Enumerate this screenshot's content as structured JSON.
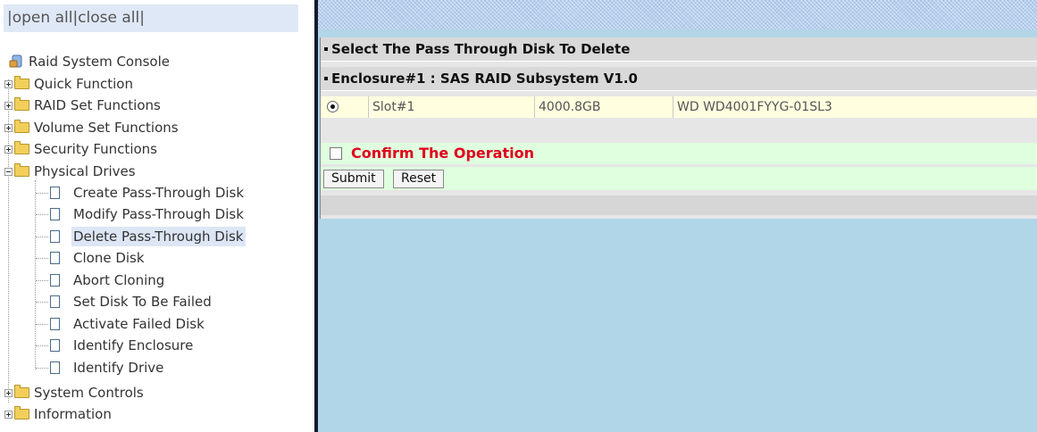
{
  "left_panel": {
    "open_all": "open all",
    "close_all": "close all",
    "separator": "|"
  },
  "tree": {
    "root": "Raid System Console",
    "folders": [
      {
        "label": "Quick Function",
        "expanded": false
      },
      {
        "label": "RAID Set Functions",
        "expanded": false
      },
      {
        "label": "Volume Set Functions",
        "expanded": false
      },
      {
        "label": "Security Functions",
        "expanded": false
      },
      {
        "label": "Physical Drives",
        "expanded": true
      },
      {
        "label": "System Controls",
        "expanded": false
      },
      {
        "label": "Information",
        "expanded": false
      }
    ],
    "physical_drive_items": [
      "Create Pass-Through Disk",
      "Modify Pass-Through Disk",
      "Delete Pass-Through Disk",
      "Clone Disk",
      "Abort Cloning",
      "Set Disk To Be Failed",
      "Activate Failed Disk",
      "Identify Enclosure",
      "Identify Drive"
    ],
    "selected_item": "Delete Pass-Through Disk"
  },
  "main": {
    "title": "Select The Pass Through Disk To Delete",
    "enclosure": "Enclosure#1 : SAS RAID Subsystem V1.0",
    "disk_row": {
      "selected": true,
      "slot": "Slot#1",
      "capacity": "4000.8GB",
      "model": "WD WD4001FYYG-01SL3"
    },
    "confirm": {
      "label": "Confirm The Operation",
      "checked": false
    },
    "buttons": {
      "submit": "Submit",
      "reset": "Reset"
    }
  },
  "colors": {
    "confirm_text": "#e0001b",
    "right_background": "#b1d6e8",
    "row_background": "#ffffe0",
    "confirm_background": "#dfffdf",
    "folder_icon": "#f2cf5b"
  },
  "icons": [
    "raid-console-icon",
    "folder-icon",
    "document-icon",
    "expand-plus-icon",
    "collapse-minus-icon",
    "radio-icon",
    "checkbox-icon"
  ]
}
